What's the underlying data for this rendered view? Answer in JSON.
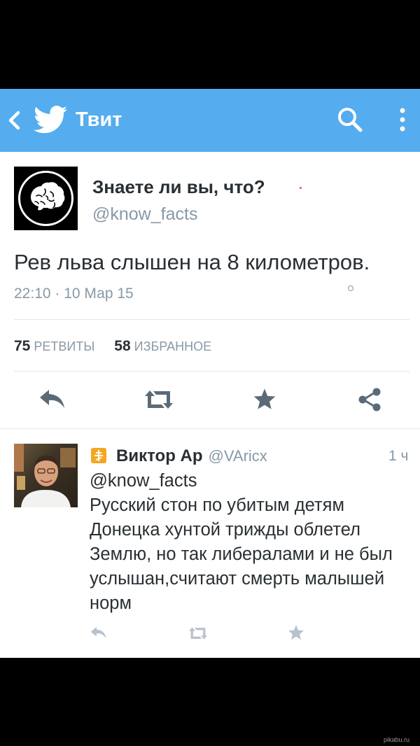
{
  "header": {
    "title": "Твит",
    "icons": {
      "back": "chevron-left-icon",
      "logo": "twitter-bird-icon",
      "search": "search-icon",
      "more": "more-vertical-icon"
    }
  },
  "tweet": {
    "author_name": "Знаете ли вы, что?",
    "author_handle": "@know_facts",
    "text": "Рев льва слышен на 8 километров.",
    "timestamp": "22:10 · 10 Мар 15",
    "retweets_count": "75",
    "retweets_label": "РЕТВИТЫ",
    "favorites_count": "58",
    "favorites_label": "ИЗБРАННОЕ"
  },
  "reply": {
    "author_name": "Виктор Ар",
    "author_handle": "@VAricx",
    "time": "1 ч",
    "mention": "@know_facts",
    "text": "Русский стон по убитым детям Донецка хунтой трижды облетел Землю, но так либералами и не был услышан,считают смерть малышей норм"
  },
  "colors": {
    "brand": "#55acee",
    "text": "#292f33",
    "muted": "#8899a6",
    "action_icon": "#5c6a78",
    "reply_action_icon": "#b8c2cb"
  },
  "watermark": "pikabu.ru"
}
